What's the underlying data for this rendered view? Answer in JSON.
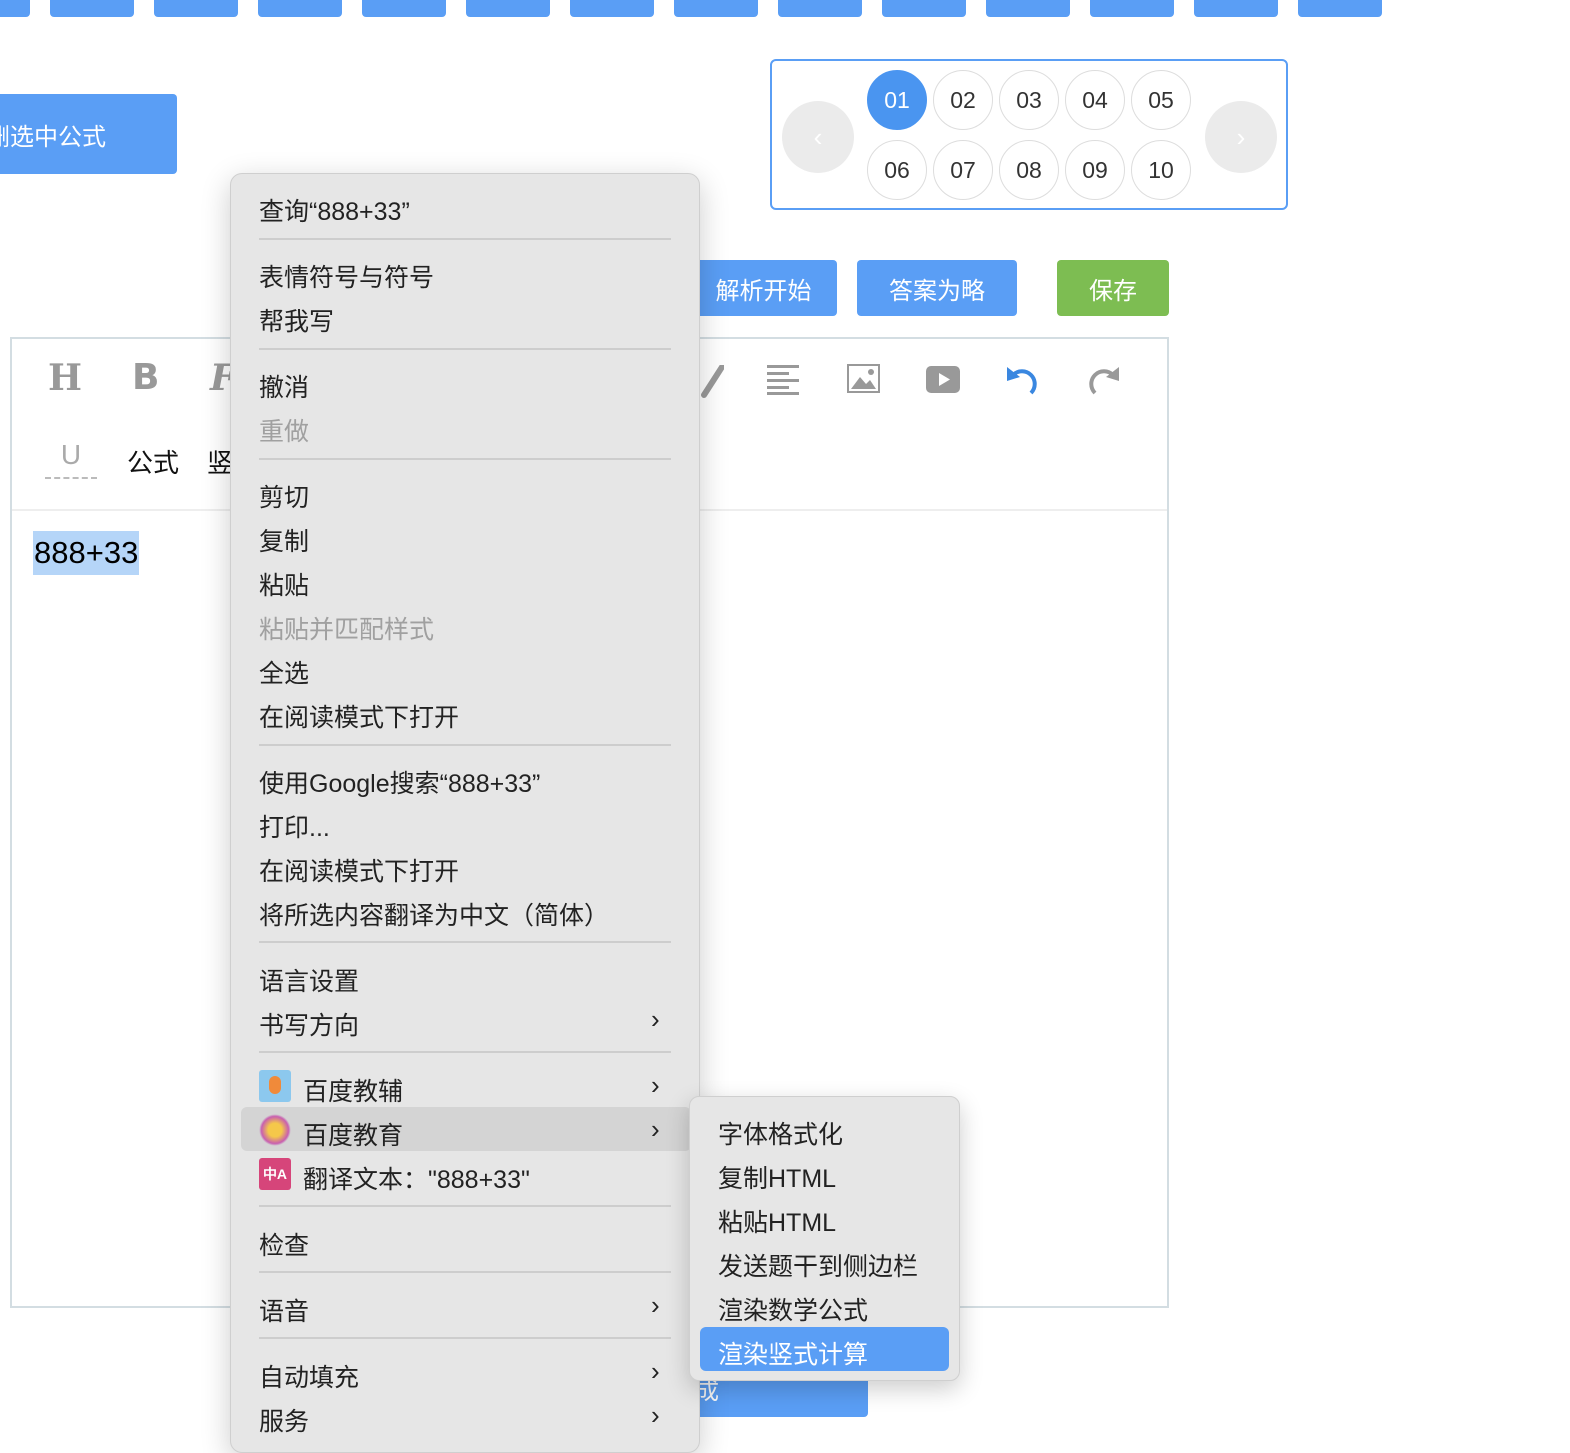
{
  "top_tabs_count": 14,
  "left_button": "删选中公式",
  "pagination": {
    "pages": [
      "01",
      "02",
      "03",
      "04",
      "05",
      "06",
      "07",
      "08",
      "09",
      "10"
    ],
    "active": "01",
    "prev": "‹",
    "next": "›"
  },
  "actions": {
    "analysis_start": "解析开始",
    "answer_omitted": "答案为略",
    "save": "保存"
  },
  "toolbar": {
    "heading": "H",
    "bold": "B",
    "font": "F",
    "underline": "U",
    "formula": "公式",
    "vertical": "竖"
  },
  "editor": {
    "content": "888+33"
  },
  "context_menu": {
    "lookup": "查询“888+33”",
    "emoji": "表情符号与符号",
    "help_write": "帮我写",
    "undo": "撤消",
    "redo": "重做",
    "cut": "剪切",
    "copy": "复制",
    "paste": "粘贴",
    "paste_match": "粘贴并匹配样式",
    "select_all": "全选",
    "reader_mode": "在阅读模式下打开",
    "google_search": "使用Google搜索“888+33”",
    "print": "打印...",
    "reader_mode2": "在阅读模式下打开",
    "translate_zh": "将所选内容翻译为中文（简体）",
    "language_settings": "语言设置",
    "writing_direction": "书写方向",
    "baidu_jiaofu": "百度教辅",
    "baidu_edu": "百度教育",
    "translate_text": "翻译文本：\"888+33\"",
    "inspect": "检查",
    "speech": "语音",
    "autofill": "自动填充",
    "services": "服务"
  },
  "submenu": {
    "items": [
      "字体格式化",
      "复制HTML",
      "粘贴HTML",
      "发送题干到侧边栏",
      "渲染数学公式",
      "渲染竖式计算"
    ],
    "highlighted": "渲染竖式计算"
  },
  "bottom_button": "成"
}
